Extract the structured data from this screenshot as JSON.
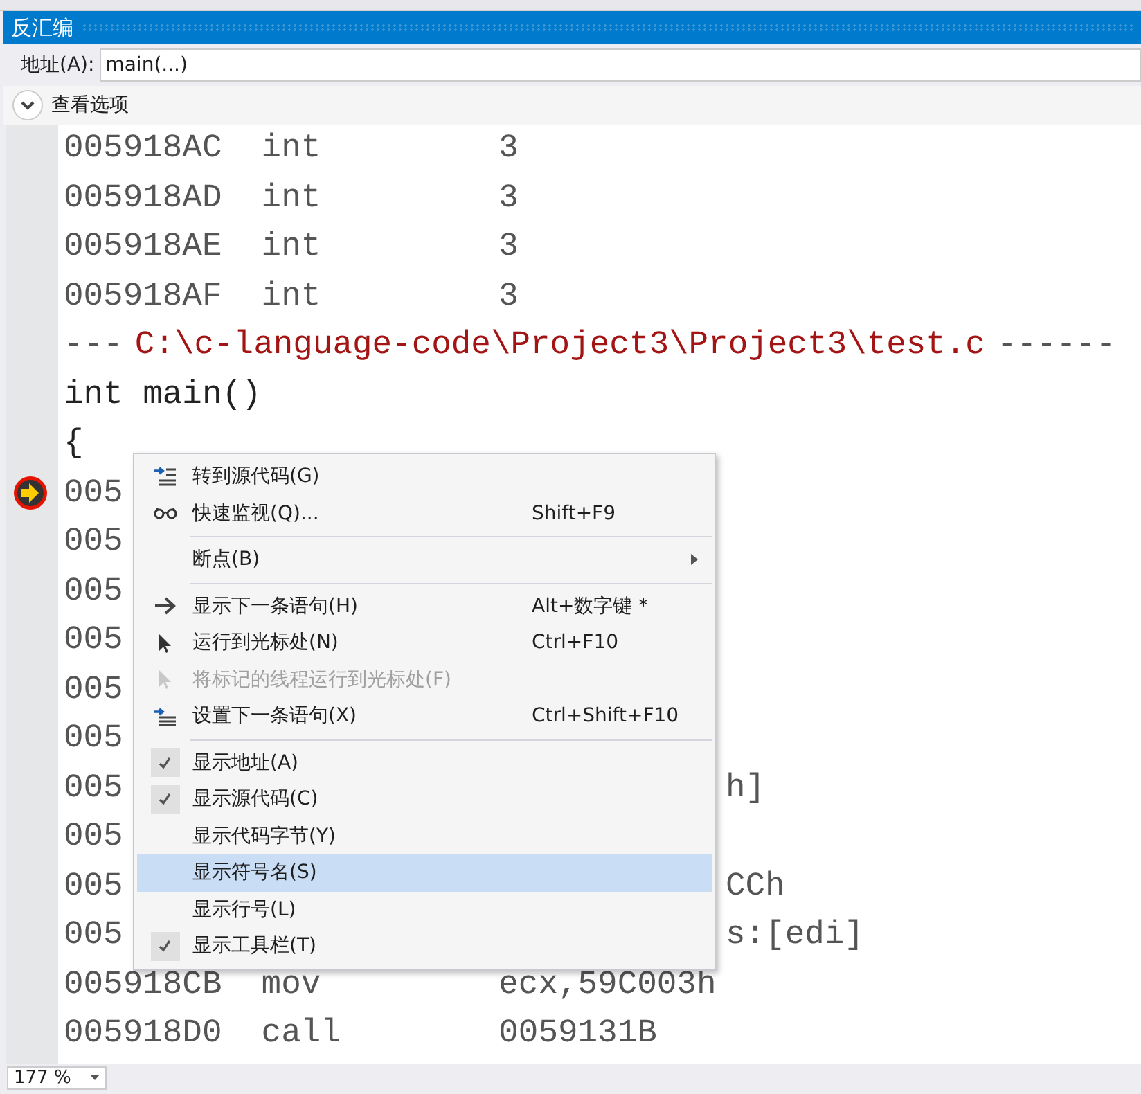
{
  "window": {
    "title": "反汇编"
  },
  "address": {
    "label": "地址(A):",
    "value": "main(...)"
  },
  "view_options": {
    "label": "查看选项",
    "expanded": false
  },
  "code_lines": [
    {
      "kind": "instr",
      "address": "005918AC",
      "mnemonic": "int",
      "operand": "3",
      "current": false
    },
    {
      "kind": "instr",
      "address": "005918AD",
      "mnemonic": "int",
      "operand": "3",
      "current": false
    },
    {
      "kind": "instr",
      "address": "005918AE",
      "mnemonic": "int",
      "operand": "3",
      "current": false
    },
    {
      "kind": "instr",
      "address": "005918AF",
      "mnemonic": "int",
      "operand": "3",
      "current": false
    },
    {
      "kind": "header",
      "prefix": "---",
      "path": "C:\\c-language-code\\Project3\\Project3\\test.c",
      "suffix": "------"
    },
    {
      "kind": "source",
      "text": "int main()"
    },
    {
      "kind": "source",
      "text": "{"
    },
    {
      "kind": "covered",
      "address": "005",
      "current": true
    },
    {
      "kind": "covered",
      "address": "005",
      "current": false
    },
    {
      "kind": "covered",
      "address": "005",
      "current": false
    },
    {
      "kind": "covered",
      "address": "005",
      "current": false
    },
    {
      "kind": "covered",
      "address": "005",
      "current": false
    },
    {
      "kind": "covered",
      "address": "005",
      "current": false
    },
    {
      "kind": "covered",
      "address": "005",
      "tail": "h]",
      "current": false
    },
    {
      "kind": "covered",
      "address": "005",
      "current": false
    },
    {
      "kind": "covered",
      "address": "005",
      "tail": "CCh",
      "current": false
    },
    {
      "kind": "covered",
      "address": "005",
      "tail": "s:[edi]",
      "current": false
    },
    {
      "kind": "instr",
      "address": "005918CB",
      "mnemonic": "mov",
      "operand": "ecx,59C003h",
      "current": false
    },
    {
      "kind": "instr",
      "address": "005918D0",
      "mnemonic": "call",
      "operand": "0059131B",
      "current": false
    }
  ],
  "context_menu": [
    {
      "kind": "goto-source",
      "label": "转到源代码(G)",
      "disabled": false,
      "selected": false
    },
    {
      "kind": "quick-watch",
      "label": "快速监视(Q)...",
      "shortcut": "Shift+F9",
      "disabled": false,
      "selected": false
    },
    {
      "kind": "separator"
    },
    {
      "kind": "submenu",
      "label": "断点(B)",
      "disabled": false,
      "selected": false
    },
    {
      "kind": "separator"
    },
    {
      "kind": "show-next",
      "label": "显示下一条语句(H)",
      "shortcut": "Alt+数字键 *",
      "disabled": false,
      "selected": false
    },
    {
      "kind": "run-to-cursor",
      "label": "运行到光标处(N)",
      "shortcut": "Ctrl+F10",
      "disabled": false,
      "selected": false
    },
    {
      "kind": "run-to-cursor",
      "label": "将标记的线程运行到光标处(F)",
      "disabled": true,
      "selected": false
    },
    {
      "kind": "set-next",
      "label": "设置下一条语句(X)",
      "shortcut": "Ctrl+Shift+F10",
      "disabled": false,
      "selected": false
    },
    {
      "kind": "separator"
    },
    {
      "kind": "option",
      "label": "显示地址(A)",
      "checked": true,
      "disabled": false,
      "selected": false
    },
    {
      "kind": "option",
      "label": "显示源代码(C)",
      "checked": true,
      "disabled": false,
      "selected": false
    },
    {
      "kind": "option",
      "label": "显示代码字节(Y)",
      "checked": false,
      "disabled": false,
      "selected": false
    },
    {
      "kind": "option",
      "label": "显示符号名(S)",
      "checked": false,
      "disabled": false,
      "selected": true
    },
    {
      "kind": "option",
      "label": "显示行号(L)",
      "checked": false,
      "disabled": false,
      "selected": false
    },
    {
      "kind": "option",
      "label": "显示工具栏(T)",
      "checked": true,
      "disabled": false,
      "selected": false
    }
  ],
  "zoom": {
    "value": "177 %"
  }
}
